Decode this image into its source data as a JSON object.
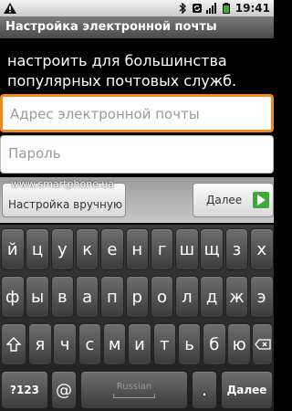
{
  "status_bar": {
    "time": "19:41",
    "icons": [
      "warning-icon",
      "bluetooth-icon",
      "sync-icon",
      "signal-icon",
      "battery-icon"
    ]
  },
  "window": {
    "title": "Настройка электронной почты"
  },
  "intro": {
    "line1": "настроить для большинства",
    "line2": "популярных почтовых служб."
  },
  "form": {
    "email_placeholder": "Адрес электронной почты",
    "password_placeholder": "Пароль"
  },
  "buttons": {
    "manual_setup": "Настройка вручную",
    "next": "Далее"
  },
  "watermark": "www.smartphone.ua",
  "keyboard": {
    "row1": [
      "й",
      "ц",
      "у",
      "к",
      "е",
      "н",
      "г",
      "ш",
      "щ",
      "з",
      "х"
    ],
    "row2": [
      "ф",
      "ы",
      "в",
      "а",
      "п",
      "р",
      "о",
      "л",
      "д",
      "ж",
      "э"
    ],
    "row3": [
      "я",
      "ч",
      "с",
      "м",
      "и",
      "т",
      "ь",
      "б",
      "ю"
    ],
    "numbers_key": "?123",
    "at_key": "@",
    "space_language": "Russian",
    "period_key": ".",
    "enter_key": "Далее"
  },
  "colors": {
    "focus_outline": "#f28a1a",
    "next_arrow": "#3fa83a"
  }
}
